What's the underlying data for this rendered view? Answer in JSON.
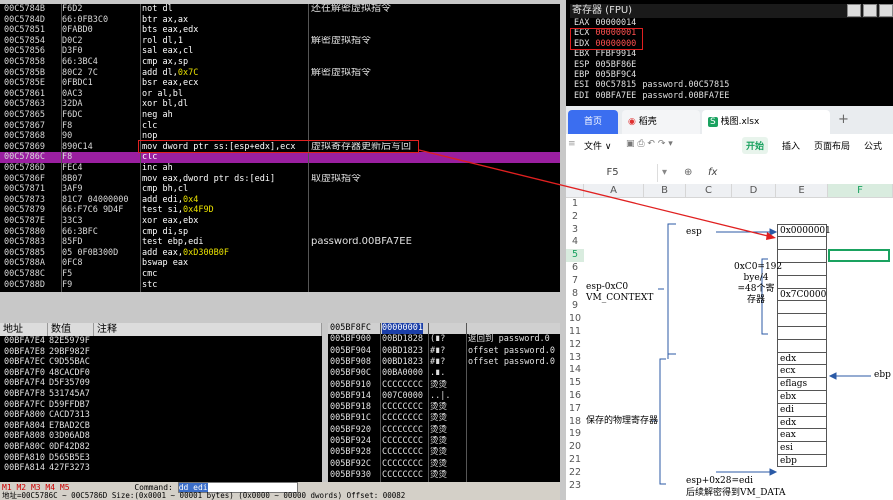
{
  "disasm": {
    "rows": [
      {
        "addr": "00C5784B",
        "bytes": "F6D2",
        "mnem": "not",
        "ops": "dl",
        "num": "",
        "cmt": "还在解密虚拟指令"
      },
      {
        "addr": "00C5784D",
        "bytes": "66:0FB3C0",
        "mnem": "btr",
        "ops": "ax,ax",
        "num": "",
        "cmt": ""
      },
      {
        "addr": "00C57851",
        "bytes": "0FABD0",
        "mnem": "bts",
        "ops": "eax,edx",
        "num": "",
        "cmt": ""
      },
      {
        "addr": "00C57854",
        "bytes": "D0C2",
        "mnem": "rol",
        "ops": "dl,1",
        "num": "",
        "cmt": "解密虚拟指令"
      },
      {
        "addr": "00C57856",
        "bytes": "D3F0",
        "mnem": "sal",
        "ops": "eax,cl",
        "num": "",
        "cmt": ""
      },
      {
        "addr": "00C57858",
        "bytes": "66:3BC4",
        "mnem": "cmp",
        "ops": "ax,sp",
        "num": "",
        "cmt": ""
      },
      {
        "addr": "00C5785B",
        "bytes": "80C2 7C",
        "mnem": "add",
        "ops": "dl,",
        "num": "0x7C",
        "cmt": "解密虚拟指令"
      },
      {
        "addr": "00C5785E",
        "bytes": "0FBDC1",
        "mnem": "bsr",
        "ops": "eax,ecx",
        "num": "",
        "cmt": ""
      },
      {
        "addr": "00C57861",
        "bytes": "0AC3",
        "mnem": "or",
        "ops": "al,bl",
        "num": "",
        "cmt": ""
      },
      {
        "addr": "00C57863",
        "bytes": "32DA",
        "mnem": "xor",
        "ops": "bl,dl",
        "num": "",
        "cmt": ""
      },
      {
        "addr": "00C57865",
        "bytes": "F6DC",
        "mnem": "neg",
        "ops": "ah",
        "num": "",
        "cmt": ""
      },
      {
        "addr": "00C57867",
        "bytes": "F8",
        "mnem": "clc",
        "ops": "",
        "num": "",
        "cmt": ""
      },
      {
        "addr": "00C57868",
        "bytes": "90",
        "mnem": "nop",
        "ops": "",
        "num": "",
        "cmt": ""
      },
      {
        "addr": "00C57869",
        "bytes": "890C14",
        "mnem": "mov",
        "ops": "dword ptr ss:[esp+edx],ecx",
        "num": "",
        "cmt": "虚拟寄存器更新后写回"
      },
      {
        "addr": "00C5786C",
        "bytes": "F8",
        "mnem": "clc",
        "ops": "",
        "num": "",
        "cmt": ""
      },
      {
        "addr": "00C5786D",
        "bytes": "FEC4",
        "mnem": "inc",
        "ops": "ah",
        "num": "",
        "cmt": ""
      },
      {
        "addr": "00C5786F",
        "bytes": "8B07",
        "mnem": "mov",
        "ops": "eax,dword ptr ds:[edi]",
        "num": "",
        "cmt": "取虚拟指令"
      },
      {
        "addr": "00C57871",
        "bytes": "3AF9",
        "mnem": "cmp",
        "ops": "bh,cl",
        "num": "",
        "cmt": ""
      },
      {
        "addr": "00C57873",
        "bytes": "81C7 04000000",
        "mnem": "add",
        "ops": "edi,",
        "num": "0x4",
        "cmt": ""
      },
      {
        "addr": "00C57879",
        "bytes": "66:F7C6 9D4F",
        "mnem": "test",
        "ops": "si,",
        "num": "0x4F9D",
        "cmt": ""
      },
      {
        "addr": "00C5787E",
        "bytes": "33C3",
        "mnem": "xor",
        "ops": "eax,ebx",
        "num": "",
        "cmt": ""
      },
      {
        "addr": "00C57880",
        "bytes": "66:3BFC",
        "mnem": "cmp",
        "ops": "di,sp",
        "num": "",
        "cmt": ""
      },
      {
        "addr": "00C57883",
        "bytes": "85FD",
        "mnem": "test",
        "ops": "ebp,edi",
        "num": "",
        "cmt": "password.00BFA7EE"
      },
      {
        "addr": "00C57885",
        "bytes": "05 0F0B300D",
        "mnem": "add",
        "ops": "eax,",
        "num": "0xD300B0F",
        "cmt": ""
      },
      {
        "addr": "00C5788A",
        "bytes": "0FC8",
        "mnem": "bswap",
        "ops": "eax",
        "num": "",
        "cmt": ""
      },
      {
        "addr": "00C5788C",
        "bytes": "F5",
        "mnem": "cmc",
        "ops": "",
        "num": "",
        "cmt": ""
      },
      {
        "addr": "00C5788D",
        "bytes": "F9",
        "mnem": "stc",
        "ops": "",
        "num": "",
        "cmt": ""
      }
    ]
  },
  "registers": {
    "title": "寄存器 (FPU)",
    "rows": [
      {
        "name": "EAX",
        "value": "00000014",
        "extra": ""
      },
      {
        "name": "ECX",
        "value": "00000001",
        "extra": ""
      },
      {
        "name": "EDX",
        "value": "00000000",
        "extra": ""
      },
      {
        "name": "EBX",
        "value": "FFBF9914",
        "extra": ""
      },
      {
        "name": "ESP",
        "value": "005BF86E",
        "extra": ""
      },
      {
        "name": "EBP",
        "value": "005BF9C4",
        "extra": ""
      },
      {
        "name": "ESI",
        "value": "00C57815",
        "extra": "password.00C57815"
      },
      {
        "name": "EDI",
        "value": "00BFA7EE",
        "extra": "password.00BFA7EE"
      }
    ]
  },
  "dump": {
    "headers": [
      "地址",
      "数值",
      "注释"
    ],
    "rows": [
      [
        "00BFA7E4",
        "82E5979F"
      ],
      [
        "00BFA7E8",
        "29BF982F"
      ],
      [
        "00BFA7EC",
        "C9D55BAC"
      ],
      [
        "00BFA7F0",
        "48CACDF0"
      ],
      [
        "00BFA7F4",
        "D5F35709"
      ],
      [
        "00BFA7F8",
        "531745A7"
      ],
      [
        "00BFA7FC",
        "D59FFDB7"
      ],
      [
        "00BFA800",
        "CACD7313"
      ],
      [
        "00BFA804",
        "E7BAD2CB"
      ],
      [
        "00BFA808",
        "03D06AD8"
      ],
      [
        "00BFA80C",
        "0DF42D82"
      ],
      [
        "00BFA810",
        "D565B5E3"
      ],
      [
        "00BFA814",
        "427F3273"
      ]
    ]
  },
  "stack": {
    "rows": [
      {
        "addr": "005BF8FC",
        "val": "00000001",
        "ascii": "",
        "cmt": ""
      },
      {
        "addr": "005BF900",
        "val": "00BD1828",
        "ascii": "(∎?",
        "cmt": "返回到 password.0"
      },
      {
        "addr": "005BF904",
        "val": "00BD1823",
        "ascii": "#∎?",
        "cmt": "offset password.0"
      },
      {
        "addr": "005BF908",
        "val": "00BD1823",
        "ascii": "#∎?",
        "cmt": "offset password.0"
      },
      {
        "addr": "005BF90C",
        "val": "00BA0000",
        "ascii": ".∎.",
        "cmt": ""
      },
      {
        "addr": "005BF910",
        "val": "CCCCCCCC",
        "ascii": "烫烫",
        "cmt": ""
      },
      {
        "addr": "005BF914",
        "val": "007C0000",
        "ascii": "..|.",
        "cmt": ""
      },
      {
        "addr": "005BF918",
        "val": "CCCCCCCC",
        "ascii": "烫烫",
        "cmt": ""
      },
      {
        "addr": "005BF91C",
        "val": "CCCCCCCC",
        "ascii": "烫烫",
        "cmt": ""
      },
      {
        "addr": "005BF920",
        "val": "CCCCCCCC",
        "ascii": "烫烫",
        "cmt": ""
      },
      {
        "addr": "005BF924",
        "val": "CCCCCCCC",
        "ascii": "烫烫",
        "cmt": ""
      },
      {
        "addr": "005BF928",
        "val": "CCCCCCCC",
        "ascii": "烫烫",
        "cmt": ""
      },
      {
        "addr": "005BF92C",
        "val": "CCCCCCCC",
        "ascii": "烫烫",
        "cmt": ""
      },
      {
        "addr": "005BF930",
        "val": "CCCCCCCC",
        "ascii": "烫烫",
        "cmt": ""
      }
    ]
  },
  "status": {
    "m1": "M1",
    "m2": "M2",
    "m3": "M3",
    "m4": "M4",
    "m5": "M5",
    "cmd_label": "Command:",
    "cmd_value": "dd edi",
    "line2": "地址=00C5786C ~ 00C5786D  Size:(0x0001 ~ 00001 bytes)    (0x0000 ~ 00000 dwords)    Offset: 00082"
  },
  "excel": {
    "tabs": {
      "home": "首页",
      "wps": "稻壳",
      "file": "栈图.xlsx"
    },
    "menu": {
      "file": "文件",
      "start": "开始",
      "insert": "插入",
      "layout": "页面布局",
      "formula": "公式"
    },
    "namebox": "F5",
    "fx": "fx",
    "columns": [
      "A",
      "B",
      "C",
      "D",
      "E",
      "F"
    ],
    "row_numbers": [
      "1",
      "2",
      "3",
      "4",
      "5",
      "6",
      "7",
      "8",
      "9",
      "10",
      "11",
      "12",
      "13",
      "14",
      "15",
      "16",
      "17",
      "18",
      "19",
      "20",
      "21",
      "22",
      "23"
    ],
    "stack_cells": [
      "0x0000001",
      "",
      "",
      "",
      "",
      "0x7C0000",
      "",
      "",
      "",
      "",
      "edx",
      "ecx",
      "eflags",
      "ebx",
      "edi",
      "edx",
      "eax",
      "esi",
      "ebp"
    ],
    "labels": {
      "esp": "esp",
      "vm_context": "esp-0xC0\nVM_CONTEXT",
      "size_note": "0xC0=192\nbye/4\n=48个寄\n存器",
      "saved_regs": "保存的物理寄存器",
      "esp_edi": "esp+0x28=edi",
      "decrypt": "后续解密得到VM_DATA",
      "ebp": "ebp"
    },
    "accent": "#1aa260"
  },
  "colors": {
    "highlight": "#9a1fa0",
    "red": "#e02020",
    "blue": "#2b5aa6"
  }
}
